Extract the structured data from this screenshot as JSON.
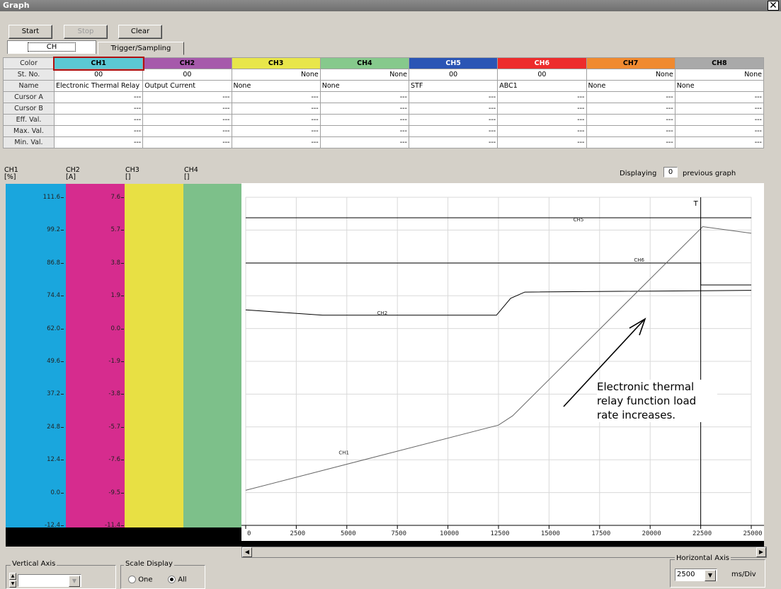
{
  "window": {
    "title": "Graph",
    "close_glyph": "✕"
  },
  "toolbar": {
    "start_label": "Start",
    "stop_label": "Stop",
    "clear_label": "Clear"
  },
  "tabs": [
    {
      "label": "CH"
    },
    {
      "label": "Trigger/Sampling"
    }
  ],
  "channel_table": {
    "row_headers": [
      "Color",
      "St. No.",
      "Name",
      "Cursor A",
      "Cursor B",
      "Eff. Val.",
      "Max. Val.",
      "Min. Val."
    ],
    "channels": [
      {
        "label": "CH1",
        "color": "#5bc8d4",
        "st_no": "00",
        "name": "Electronic Thermal Relay"
      },
      {
        "label": "CH2",
        "color": "#a65aab",
        "st_no": "00",
        "name": "Output Current"
      },
      {
        "label": "CH3",
        "color": "#e8e64a",
        "st_no": "None",
        "name": "None"
      },
      {
        "label": "CH4",
        "color": "#86c98c",
        "st_no": "None",
        "name": "None"
      },
      {
        "label": "CH5",
        "color": "#2a55b5",
        "st_no": "00",
        "name": "STF"
      },
      {
        "label": "CH6",
        "color": "#ed2c2c",
        "st_no": "00",
        "name": "ABC1"
      },
      {
        "label": "CH7",
        "color": "#f08a30",
        "st_no": "None",
        "name": "None"
      },
      {
        "label": "CH8",
        "color": "#a9a9a9",
        "st_no": "None",
        "name": "None"
      }
    ],
    "empty_value": "---"
  },
  "axis_headers": [
    {
      "name": "CH1",
      "unit": "[%]"
    },
    {
      "name": "CH2",
      "unit": "[A]"
    },
    {
      "name": "CH3",
      "unit": "[]"
    },
    {
      "name": "CH4",
      "unit": "[]"
    }
  ],
  "displaying": {
    "label": "Displaying",
    "value": "0",
    "suffix": "previous graph"
  },
  "vertical_scales": {
    "ch1_ticks": [
      "111.6",
      "99.2",
      "86.8",
      "74.4",
      "62.0",
      "49.6",
      "37.2",
      "24.8",
      "12.4",
      "0.0",
      "-12.4"
    ],
    "ch2_ticks": [
      "7.6",
      "5.7",
      "3.8",
      "1.9",
      "0.0",
      "-1.9",
      "-3.8",
      "-5.7",
      "-7.6",
      "-9.5",
      "-11.4"
    ],
    "strip_colors": [
      "#1aa6dd",
      "#d62c8e",
      "#e8e044",
      "#7dc08a"
    ]
  },
  "chart_data": {
    "type": "line",
    "x_ticks": [
      "0",
      "2500",
      "5000",
      "7500",
      "10000",
      "12500",
      "15000",
      "17500",
      "20000",
      "22500",
      "25000"
    ],
    "xlim": [
      0,
      25000
    ],
    "x_unit": "ms",
    "series": [
      {
        "name": "CH1",
        "x": [
          0,
          12500,
          13200,
          22600,
          25000
        ],
        "y": [
          0.85,
          25.5,
          29.0,
          100.5,
          98.0
        ]
      },
      {
        "name": "CH2",
        "x": [
          0,
          3800,
          12400,
          13100,
          13800,
          25000
        ],
        "y": [
          1.08,
          0.77,
          0.77,
          1.75,
          2.11,
          2.21
        ]
      },
      {
        "name": "CH5",
        "x": [
          0,
          25000
        ],
        "y": [
          "ON",
          "ON"
        ]
      },
      {
        "name": "CH6",
        "x": [
          0,
          22500,
          22500,
          25000
        ],
        "y": [
          "ON",
          "ON",
          "OFF",
          "OFF"
        ]
      }
    ],
    "cursor_label": "T",
    "cursor_x": 22500,
    "grid": true
  },
  "annotation": {
    "lines": [
      "Electronic thermal",
      "relay function load",
      "rate increases."
    ]
  },
  "vertical_axis": {
    "label": "Vertical Axis",
    "value": ""
  },
  "scale_display": {
    "label": "Scale Display",
    "options": [
      "One",
      "All"
    ],
    "selected": "All"
  },
  "horizontal_axis": {
    "label": "Horizontal Axis",
    "value": "2500",
    "unit": "ms/Div"
  }
}
